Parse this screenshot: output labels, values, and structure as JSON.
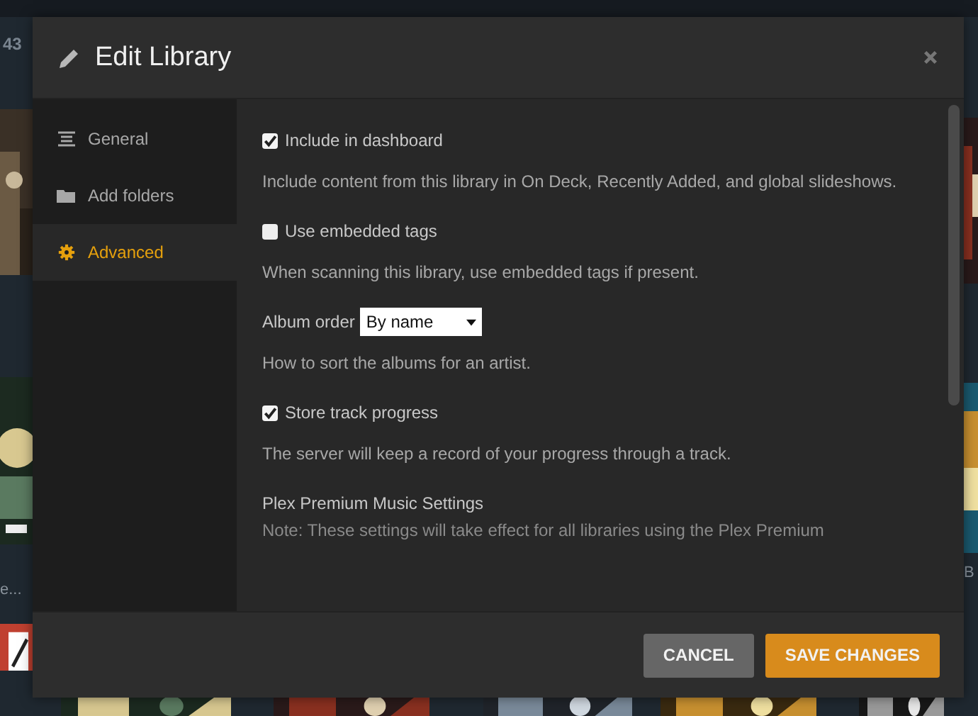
{
  "background": {
    "count": "43",
    "captions": [
      "e...",
      "B"
    ]
  },
  "dialog": {
    "title": "Edit Library",
    "sidebar": [
      {
        "label": "General",
        "selected": false
      },
      {
        "label": "Add folders",
        "selected": false
      },
      {
        "label": "Advanced",
        "selected": true
      }
    ],
    "settings": [
      {
        "kind": "checkbox",
        "label": "Include in dashboard",
        "checked": true,
        "help": "Include content from this library in On Deck, Recently Added, and global slideshows."
      },
      {
        "kind": "checkbox",
        "label": "Use embedded tags",
        "checked": false,
        "help": "When scanning this library, use embedded tags if present."
      },
      {
        "kind": "select",
        "label": "Album order",
        "value": "By name",
        "help": "How to sort the albums for an artist."
      },
      {
        "kind": "checkbox",
        "label": "Store track progress",
        "checked": true,
        "help": "The server will keep a record of your progress through a track."
      },
      {
        "kind": "heading",
        "label": "Plex Premium Music Settings",
        "help": "Note: These settings will take effect for all libraries using the Plex Premium"
      }
    ],
    "buttons": [
      {
        "label": "CANCEL",
        "kind": "secondary"
      },
      {
        "label": "SAVE CHANGES",
        "kind": "primary"
      }
    ]
  }
}
